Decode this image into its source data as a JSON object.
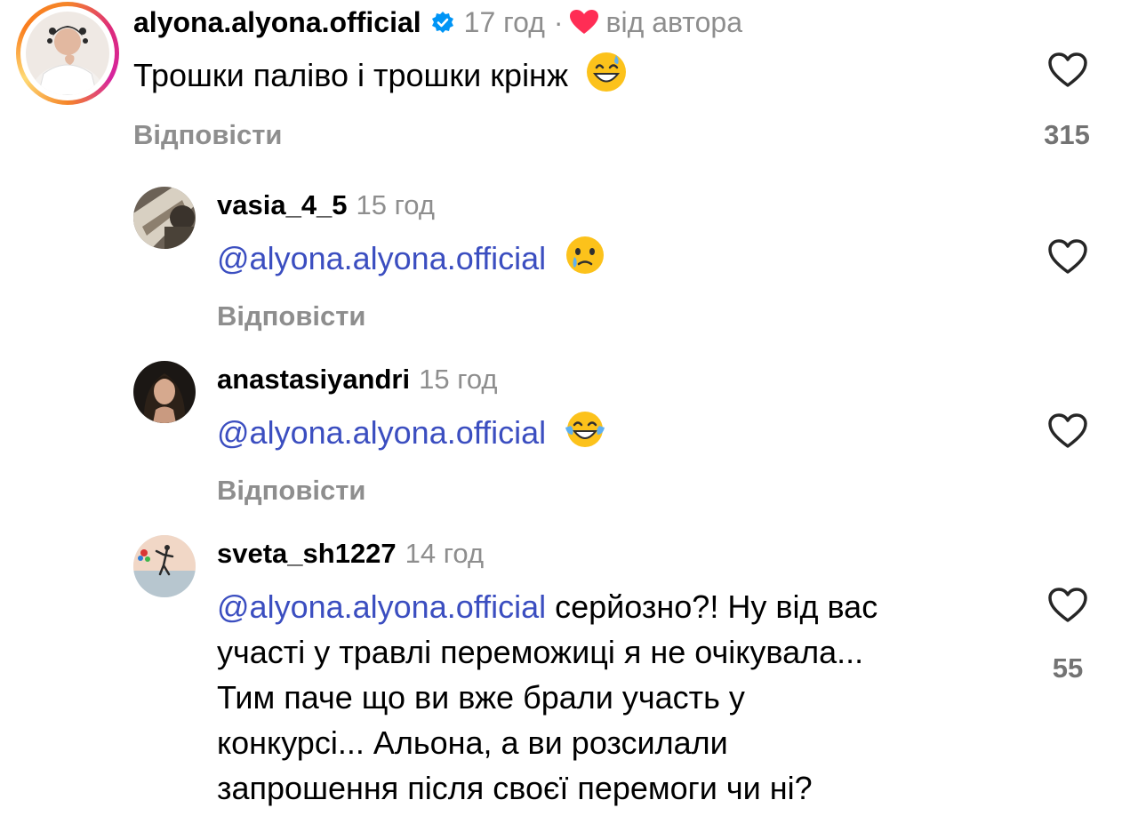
{
  "comments": [
    {
      "username": "alyona.alyona.official",
      "time": "17 год",
      "dot": "·",
      "author_like_label": "від автора",
      "text": "Трошки паліво і трошки крінж",
      "emoji": "grinning-face-with-sweat",
      "reply_label": "Відповісти",
      "likes": "315"
    },
    {
      "username": "vasia_4_5",
      "time": "15 год",
      "mention": "@alyona.alyona.official",
      "emoji": "face-holding-back-tears",
      "reply_label": "Відповісти"
    },
    {
      "username": "anastasiyandri",
      "time": "15 год",
      "mention": "@alyona.alyona.official",
      "emoji": "face-with-tears-of-joy",
      "reply_label": "Відповісти"
    },
    {
      "username": "sveta_sh1227",
      "time": "14 год",
      "mention": "@alyona.alyona.official",
      "text_line1": "серйозно?! Ну від вас",
      "text_line2": "участі у травлі переможиці я не очікувала...",
      "text_line3": "Тим паче що ви вже брали участь у",
      "text_line4": "конкурсі... Альона, а ви розсилали",
      "text_line5": "запрошення після своєї перемоги чи ні?",
      "likes": "55"
    }
  ],
  "colors": {
    "mention": "#3b4ec0",
    "secondary": "#8e8e8e",
    "verified": "#0095f6",
    "heart_red": "#ff2d55"
  }
}
